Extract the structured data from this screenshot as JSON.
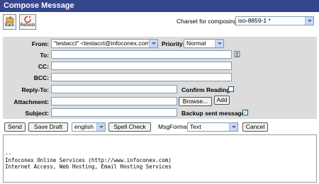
{
  "title": "Compose Message",
  "toolbar": {
    "back_label": "Back",
    "refresh_label": "Refresh"
  },
  "charset": {
    "label": "Charset for composing:",
    "value": "iso-8859-1 *"
  },
  "fields": {
    "from_label": "From:",
    "from_value": "\"testacct\" <testacct@infoconex.com>",
    "priority_label": "Priority:",
    "priority_value": "Normal",
    "to_label": "To:",
    "to_value": "",
    "cc_label": "CC:",
    "cc_value": "",
    "bcc_label": "BCC:",
    "bcc_value": "",
    "replyto_label": "Reply-To:",
    "replyto_value": "",
    "confirm_label": "Confirm Reading",
    "attachment_label": "Attachment:",
    "browse_label": "Browse...",
    "add_label": "Add",
    "subject_label": "Subject:",
    "subject_value": "",
    "backup_label": "Backup sent message",
    "backup_checked": "✓"
  },
  "actions": {
    "send_label": "Send",
    "save_draft_label": "Save Draft",
    "language_value": "english",
    "spell_check_label": "Spell Check",
    "msgformat_label": "MsgFormat",
    "msgformat_value": "Text",
    "cancel_label": "Cancel"
  },
  "body": {
    "text": "--\nInfoconex Online Services (http://www.infoconex.com)\nInternet Access, Web Hosting, Email Hosting Services"
  },
  "colors": {
    "title_bar": "#35468c",
    "form_background": "#dcdcdc"
  }
}
